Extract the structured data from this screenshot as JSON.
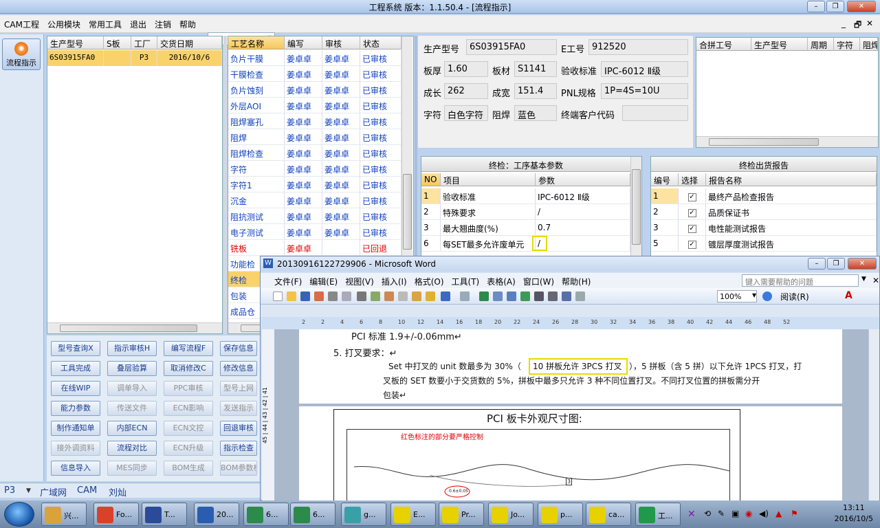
{
  "app": {
    "title": "工程系统   版本：1.1.50.4 - [流程指示]",
    "window_buttons": [
      "–",
      "❐",
      "✕"
    ],
    "menu": [
      "CAM工程",
      "公用模块",
      "常用工具",
      "退出",
      "注销",
      "帮助"
    ],
    "mdi_buttons": [
      "_",
      "🗗",
      "✕"
    ]
  },
  "left_strip": {
    "flow_button": "流程指示"
  },
  "orders": {
    "columns": [
      "生产型号",
      "S板",
      "工厂",
      "交货日期"
    ],
    "rows": [
      {
        "model": "6S03915FA0",
        "s": "",
        "factory": "P3",
        "date": "2016/10/6"
      }
    ]
  },
  "process": {
    "columns": [
      "工艺名称",
      "编写",
      "审核",
      "状态"
    ],
    "rows": [
      {
        "name": "负片干膜",
        "writer": "姜卓卓",
        "reviewer": "姜卓卓",
        "status": "已审核"
      },
      {
        "name": "干膜检查",
        "writer": "姜卓卓",
        "reviewer": "姜卓卓",
        "status": "已审核"
      },
      {
        "name": "负片蚀刻",
        "writer": "姜卓卓",
        "reviewer": "姜卓卓",
        "status": "已审核"
      },
      {
        "name": "外层AOI",
        "writer": "姜卓卓",
        "reviewer": "姜卓卓",
        "status": "已审核"
      },
      {
        "name": "阻焊塞孔",
        "writer": "姜卓卓",
        "reviewer": "姜卓卓",
        "status": "已审核"
      },
      {
        "name": "阻焊",
        "writer": "姜卓卓",
        "reviewer": "姜卓卓",
        "status": "已审核"
      },
      {
        "name": "阻焊检查",
        "writer": "姜卓卓",
        "reviewer": "姜卓卓",
        "status": "已审核"
      },
      {
        "name": "字符",
        "writer": "姜卓卓",
        "reviewer": "姜卓卓",
        "status": "已审核"
      },
      {
        "name": "字符1",
        "writer": "姜卓卓",
        "reviewer": "姜卓卓",
        "status": "已审核"
      },
      {
        "name": "沉金",
        "writer": "姜卓卓",
        "reviewer": "姜卓卓",
        "status": "已审核"
      },
      {
        "name": "阻抗测试",
        "writer": "姜卓卓",
        "reviewer": "姜卓卓",
        "status": "已审核"
      },
      {
        "name": "电子测试",
        "writer": "姜卓卓",
        "reviewer": "姜卓卓",
        "status": "已审核"
      },
      {
        "name": "铣板",
        "writer": "姜卓卓",
        "reviewer": "",
        "status": "已回退"
      },
      {
        "name": "功能检",
        "writer": "",
        "reviewer": "",
        "status": ""
      },
      {
        "name": "终检",
        "writer": "",
        "reviewer": "",
        "status": ""
      },
      {
        "name": "包装",
        "writer": "",
        "reviewer": "",
        "status": ""
      },
      {
        "name": "成品仓",
        "writer": "",
        "reviewer": "",
        "status": ""
      }
    ]
  },
  "func_buttons": [
    {
      "label": "型号查询X",
      "enabled": true
    },
    {
      "label": "指示审核H",
      "enabled": true
    },
    {
      "label": "编写流程F",
      "enabled": true
    },
    {
      "label": "保存信息",
      "enabled": true
    },
    {
      "label": "工具完成",
      "enabled": true
    },
    {
      "label": "叠层验算",
      "enabled": true
    },
    {
      "label": "取消修改C",
      "enabled": true
    },
    {
      "label": "修改信息",
      "enabled": true
    },
    {
      "label": "在线WIP",
      "enabled": true
    },
    {
      "label": "调单导入",
      "enabled": false
    },
    {
      "label": "PPC审核",
      "enabled": false
    },
    {
      "label": "型号上网",
      "enabled": false
    },
    {
      "label": "能力参数",
      "enabled": true
    },
    {
      "label": "传送文件",
      "enabled": false
    },
    {
      "label": "ECN影响",
      "enabled": false
    },
    {
      "label": "发送指示",
      "enabled": false
    },
    {
      "label": "制作通知单",
      "enabled": true
    },
    {
      "label": "内部ECN",
      "enabled": true
    },
    {
      "label": "ECN文控",
      "enabled": false
    },
    {
      "label": "回退审核",
      "enabled": true
    },
    {
      "label": "接外调资料",
      "enabled": false
    },
    {
      "label": "流程对比",
      "enabled": true
    },
    {
      "label": "ECN升级",
      "enabled": false
    },
    {
      "label": "指示检查",
      "enabled": true
    },
    {
      "label": "信息导入",
      "enabled": true
    },
    {
      "label": "MES同步",
      "enabled": false
    },
    {
      "label": "BOM生成",
      "enabled": false
    },
    {
      "label": "BOM参数核",
      "enabled": false
    }
  ],
  "statusbar": {
    "factory": "P3",
    "items": [
      "广域网",
      "CAM",
      "刘灿"
    ]
  },
  "info": {
    "model_label": "生产型号",
    "model": "6S03915FA0",
    "e_label": "E工号",
    "e_no": "912520",
    "thick_label": "板厚",
    "thick": "1.60",
    "mat_label": "板材",
    "mat": "S1141",
    "std_label": "验收标准",
    "std": "IPC-6012 Ⅱ级",
    "len_label": "成长",
    "len": "262",
    "wid_label": "成宽",
    "wid": "151.4",
    "pnl_label": "PNL规格",
    "pnl": "1P=4S=10U",
    "char_label": "字符",
    "char": "白色字符",
    "mask_label": "阻焊",
    "mask": "蓝色",
    "cust_label": "终端客户代码",
    "cust": ""
  },
  "combine": {
    "columns": [
      "合拼工号",
      "生产型号",
      "周期",
      "字符",
      "阻焊"
    ]
  },
  "params": {
    "title": "终检：工序基本参数",
    "columns": [
      "NO",
      "项目",
      "参数"
    ],
    "rows": [
      {
        "no": "1",
        "item": "验收标准",
        "val": "IPC-6012 Ⅱ级"
      },
      {
        "no": "2",
        "item": "特殊要求",
        "val": "/"
      },
      {
        "no": "3",
        "item": "最大翘曲度(%)",
        "val": "0.7"
      },
      {
        "no": "6",
        "item": "每SET最多允许废单元",
        "val": "/"
      }
    ]
  },
  "report": {
    "title": "终检出货报告",
    "columns": [
      "编号",
      "选择",
      "报告名称"
    ],
    "rows": [
      {
        "no": "1",
        "name": "最终产品检查报告"
      },
      {
        "no": "2",
        "name": "品质保证书"
      },
      {
        "no": "3",
        "name": "电性能测试报告"
      },
      {
        "no": "5",
        "name": "镀层厚度测试报告"
      }
    ]
  },
  "word": {
    "title": "20130916122729906 - Microsoft Word",
    "menu": [
      "文件(F)",
      "编辑(E)",
      "视图(V)",
      "插入(I)",
      "格式(O)",
      "工具(T)",
      "表格(A)",
      "窗口(W)",
      "帮助(H)"
    ],
    "help_placeholder": "键入需要帮助的问题",
    "zoom": "100%",
    "read_btn": "阅读(R)",
    "ruler": [
      "2",
      "2",
      "4",
      "6",
      "8",
      "10",
      "12",
      "14",
      "16",
      "18",
      "20",
      "22",
      "24",
      "26",
      "28",
      "30",
      "32",
      "34",
      "36",
      "38",
      "40",
      "42",
      "44",
      "46",
      "48",
      "52"
    ],
    "vruler": "45 | 44 | 43 | 42 | 41",
    "line1": "PCI 标准 1.9+/-0.06mm↵",
    "line2": "5. 打叉要求：↵",
    "line3a": "Set 中打叉的 unit 数最多为 30%（",
    "line3hl": "10 拼板允许 3PCS 打叉",
    "line3b": "），5 拼板（含 5 拼）以下允许 1PCS 打叉，打",
    "line4": "叉板的 SET 数要小于交货数的 5%，拼板中最多只允许 3 种不同位置打叉。不同打叉位置的拼板需分开",
    "line5": "包装↵",
    "fig_title": "PCI 板卡外观尺寸图:",
    "fig_note": "红色标注的部分要严格控制",
    "fig_circle": "0.6±0.05",
    "fig_mark": "3"
  },
  "taskbar": {
    "items": [
      "兴...",
      "Fo...",
      "T...",
      "20...",
      "6...",
      "6...",
      "g...",
      "E...",
      "Pr...",
      "Jo...",
      "p...",
      "ca...",
      "工..."
    ],
    "time": "13:11",
    "date": "2016/10/5"
  }
}
